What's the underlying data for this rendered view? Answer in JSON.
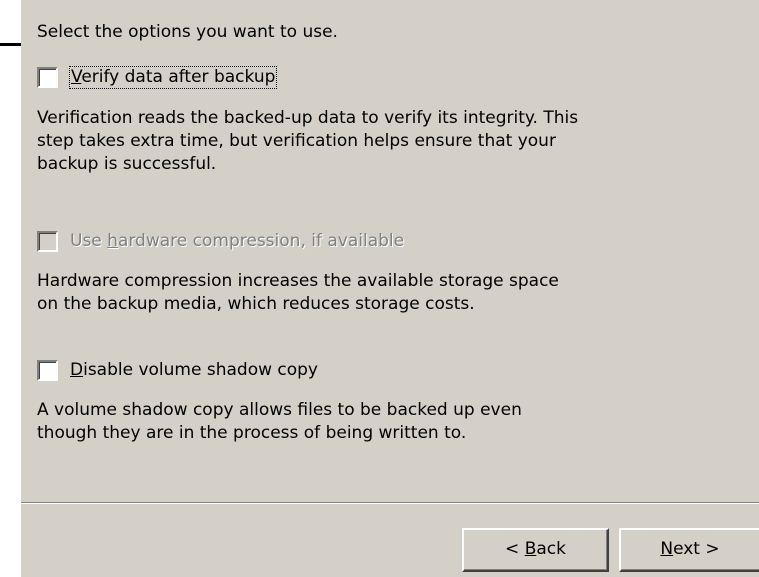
{
  "instruction": "Select the options you want to use.",
  "options": [
    {
      "label_prefix": "",
      "label_mnemonic": "V",
      "label_rest": "erify data after backup",
      "checked": false,
      "enabled": true,
      "focused": true,
      "description": "Verification reads the backed-up data to verify its integrity. This\nstep takes extra time, but verification helps ensure that your\nbackup is successful."
    },
    {
      "label_prefix": "Use ",
      "label_mnemonic": "h",
      "label_rest": "ardware compression, if available",
      "checked": false,
      "enabled": false,
      "focused": false,
      "description": "Hardware compression increases the available storage space\non the backup media, which reduces storage costs."
    },
    {
      "label_prefix": "",
      "label_mnemonic": "D",
      "label_rest": "isable volume shadow copy",
      "checked": false,
      "enabled": true,
      "focused": false,
      "description": "A volume shadow copy allows files to be backed up even\nthough they are in the process of being written to."
    }
  ],
  "buttons": {
    "back": {
      "prefix": "< ",
      "mnemonic": "B",
      "rest": "ack"
    },
    "next": {
      "prefix": "",
      "mnemonic": "N",
      "rest": "ext >"
    }
  },
  "colors": {
    "dialog_bg": "#d4d0c8",
    "disabled_text": "#808080"
  }
}
